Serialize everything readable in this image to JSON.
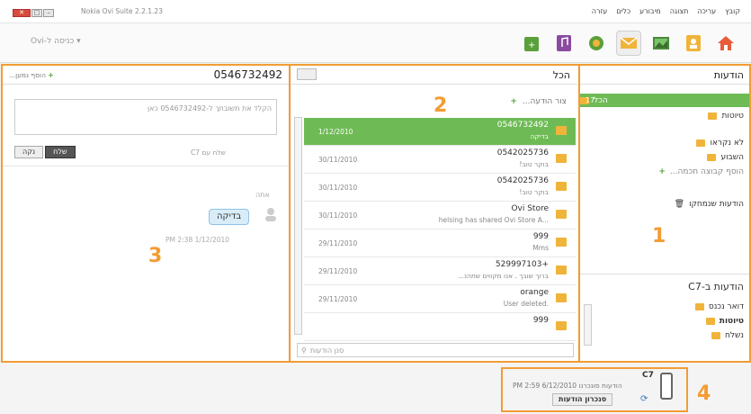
{
  "window": {
    "title": "Nokia Ovi Suite 2.2.1.23"
  },
  "menu": [
    "קובץ",
    "עריכה",
    "תצוגה",
    "מיבורע",
    "כלים",
    "עזרה"
  ],
  "toolbar": {
    "ovi_login": "כניסה ל-Ovi"
  },
  "folders": {
    "title": "הודעות",
    "items": [
      {
        "label": "הכל",
        "count": "17",
        "selected": true
      },
      {
        "label": "טיוטות"
      },
      {
        "label": "לא נקראו"
      },
      {
        "label": "השבוע"
      },
      {
        "label": "הוסף קבוצה חכמה..."
      },
      {
        "label": "הודעות שנמחקו"
      }
    ],
    "device_title": "הודעות ב-C7",
    "device_items": [
      {
        "label": "דואר נכנס"
      },
      {
        "label": "טיוטות"
      },
      {
        "label": "נשלח"
      }
    ]
  },
  "list": {
    "title": "הכל",
    "compose": "צור הודעה...",
    "search_placeholder": "סנן הודעות",
    "messages": [
      {
        "name": "0546732492",
        "preview": "בדיקה",
        "date": "1/12/2010",
        "selected": true
      },
      {
        "name": "0542025736",
        "preview": "בוקר טוב!",
        "date": "30/11/2010"
      },
      {
        "name": "0542025736",
        "preview": "בוקר טוב!",
        "date": "30/11/2010"
      },
      {
        "name": "Ovi Store",
        "preview": "...helsing has shared Ovi Store A",
        "date": "30/11/2010"
      },
      {
        "name": "999",
        "preview": "Mms",
        "date": "29/11/2010"
      },
      {
        "name": "529997103+",
        "preview": "ברוך שובך . אנו מקווים שתהנ...",
        "date": "29/11/2010"
      },
      {
        "name": "orange",
        "preview": ".User deleted",
        "date": "29/11/2010"
      },
      {
        "name": "999",
        "preview": "",
        "date": ""
      }
    ]
  },
  "conversation": {
    "number": "0546732492",
    "add_recipient": "הוסף נמען...",
    "placeholder": "הקלד את תשובתך ל-0546732492 כאן",
    "send_with": "שלח עם C7",
    "send": "שלח",
    "clear": "נקה",
    "sender": "אתה",
    "bubble": "בדיקה",
    "time": "PM 2:38 1/12/2010"
  },
  "device": {
    "name": "C7",
    "status": "הודעות סונכרנו 6/12/2010 PM 2:59",
    "sync": "סנכרון הודעות"
  },
  "annotations": {
    "n1": "1",
    "n2": "2",
    "n3": "3",
    "n4": "4"
  },
  "colors": {
    "accent": "#f39c34",
    "selected": "#6ebb55"
  }
}
